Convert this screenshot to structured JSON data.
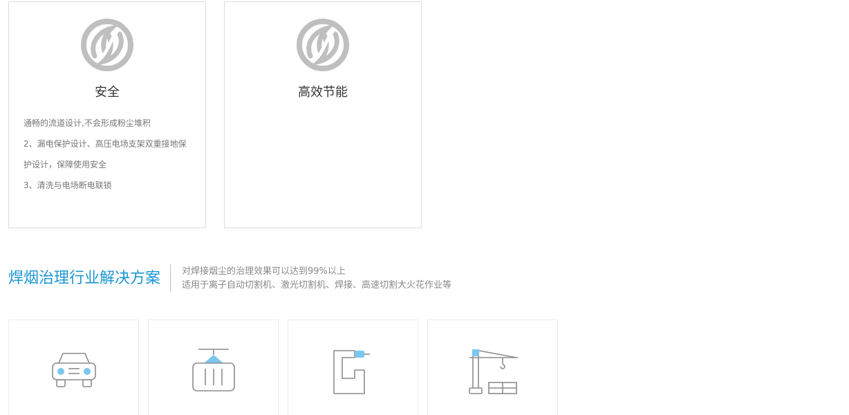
{
  "features": [
    {
      "title": "安全",
      "icon": "swirl-logo-icon",
      "lines": [
        "通畅的流道设计,不会形成粉尘堆积",
        "2、漏电保护设计、高压电场支架双重接地保",
        "护设计，保障使用安全",
        "3、清洗与电场断电联锁"
      ]
    },
    {
      "title": "高效节能",
      "icon": "swirl-logo-icon",
      "lines": []
    }
  ],
  "solutions_section": {
    "title": "焊烟治理行业解决方案",
    "subtitle_line1": "对焊接烟尘的治理效果可以达到99%以上",
    "subtitle_line2": "适用于离子自动切割机、激光切割机、焊接、高速切割大火花作业等"
  },
  "solution_tiles": [
    {
      "icon": "car-icon"
    },
    {
      "icon": "gantry-crane-icon"
    },
    {
      "icon": "cnc-machine-icon"
    },
    {
      "icon": "tower-crane-icon"
    }
  ],
  "colors": {
    "accent": "#1b96d2",
    "icon_highlight": "#7ac7ee",
    "icon_stroke": "#8c8c8c",
    "logo_gray": "#bfbfbf",
    "card_border": "#dcdcdc"
  }
}
